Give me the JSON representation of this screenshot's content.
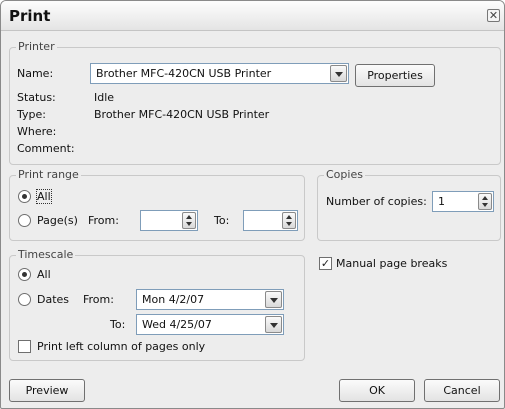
{
  "title": "Print",
  "icons": {
    "close": "close-icon",
    "dropdown": "chevron-down-icon",
    "spinner": "spinner-arrows-icon"
  },
  "printer": {
    "legend": "Printer",
    "name_label": "Name:",
    "name_value": "Brother MFC-420CN USB Printer",
    "properties_label": "Properties",
    "status_label": "Status:",
    "status_value": "Idle",
    "type_label": "Type:",
    "type_value": "Brother MFC-420CN USB Printer",
    "where_label": "Where:",
    "where_value": "",
    "comment_label": "Comment:",
    "comment_value": ""
  },
  "print_range": {
    "legend": "Print range",
    "all_label": "All",
    "pages_label": "Page(s)",
    "from_label": "From:",
    "to_label": "To:",
    "from_value": "",
    "to_value": "",
    "selected": "all"
  },
  "copies": {
    "legend": "Copies",
    "number_label": "Number of copies:",
    "number_value": "1"
  },
  "timescale": {
    "legend": "Timescale",
    "all_label": "All",
    "dates_label": "Dates",
    "from_label": "From:",
    "from_value": "Mon 4/2/07",
    "to_label": "To:",
    "to_value": "Wed 4/25/07",
    "selected": "all",
    "print_left_column_label": "Print left column of pages only",
    "print_left_column_checked": false
  },
  "manual_page_breaks": {
    "label": "Manual page breaks",
    "checked": true
  },
  "buttons": {
    "preview": "Preview",
    "ok": "OK",
    "cancel": "Cancel"
  }
}
